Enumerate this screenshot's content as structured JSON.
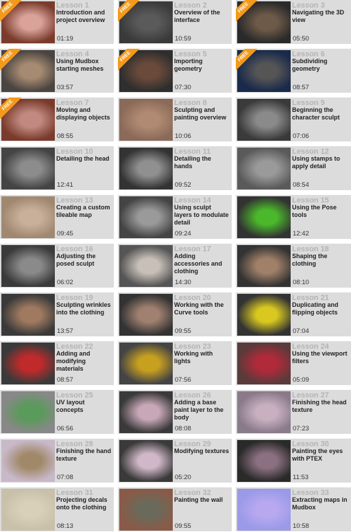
{
  "badge_label": "FREE",
  "lessons": [
    {
      "label": "Lesson 1",
      "title": "Introduction and project overview",
      "duration": "01:19",
      "free": true,
      "thumb_colors": [
        "#7a3b2c",
        "#d9a39a",
        "#e8e4de"
      ]
    },
    {
      "label": "Lesson 2",
      "title": "Overview of the interface",
      "duration": "10:59",
      "free": true,
      "thumb_colors": [
        "#3a3a3a",
        "#5a5a5a",
        "#8a8f99"
      ]
    },
    {
      "label": "Lesson 3",
      "title": "Navigating the 3D view",
      "duration": "05:50",
      "free": true,
      "thumb_colors": [
        "#2a2a2a",
        "#6e5a48",
        "#3c3c3c"
      ]
    },
    {
      "label": "Lesson 4",
      "title": "Using Mudbox starting meshes",
      "duration": "03:57",
      "free": true,
      "thumb_colors": [
        "#4a4540",
        "#a68a72",
        "#7a6656"
      ]
    },
    {
      "label": "Lesson 5",
      "title": "Importing geometry",
      "duration": "07:30",
      "free": true,
      "thumb_colors": [
        "#2e2e2e",
        "#6a4a3a",
        "#c8b020"
      ]
    },
    {
      "label": "Lesson 6",
      "title": "Subdividing geometry",
      "duration": "08:57",
      "free": true,
      "thumb_colors": [
        "#1a2a4a",
        "#555",
        "#777"
      ]
    },
    {
      "label": "Lesson 7",
      "title": "Moving and displaying objects",
      "duration": "08:55",
      "free": true,
      "thumb_colors": [
        "#7a3b2c",
        "#c08a80",
        "#6a3a3a"
      ]
    },
    {
      "label": "Lesson 8",
      "title": "Sculpting and painting overview",
      "duration": "10:06",
      "free": false,
      "thumb_colors": [
        "#8a6a58",
        "#b08a72",
        "#6a4e40"
      ]
    },
    {
      "label": "Lesson 9",
      "title": "Beginning the character sculpt",
      "duration": "07:06",
      "free": false,
      "thumb_colors": [
        "#3a3a3a",
        "#8a8a8a",
        "#4a4a4a"
      ]
    },
    {
      "label": "Lesson 10",
      "title": "Detailing the head",
      "duration": "12:41",
      "free": false,
      "thumb_colors": [
        "#444",
        "#8c8c8c",
        "#555"
      ]
    },
    {
      "label": "Lesson 11",
      "title": "Detailing the hands",
      "duration": "09:52",
      "free": false,
      "thumb_colors": [
        "#333",
        "#909090",
        "#444"
      ]
    },
    {
      "label": "Lesson 12",
      "title": "Using stamps to apply detail",
      "duration": "08:54",
      "free": false,
      "thumb_colors": [
        "#5a5a5a",
        "#9a9a9a",
        "#6a6a6a"
      ]
    },
    {
      "label": "Lesson 13",
      "title": "Creating a custom tileable map",
      "duration": "09:45",
      "free": false,
      "thumb_colors": [
        "#a08870",
        "#c8b09a",
        "#8a7058"
      ]
    },
    {
      "label": "Lesson 14",
      "title": "Using sculpt layers to modulate detail",
      "duration": "09:24",
      "free": false,
      "thumb_colors": [
        "#444",
        "#9a9a9a",
        "#555"
      ]
    },
    {
      "label": "Lesson 15",
      "title": "Using the Pose tools",
      "duration": "12:42",
      "free": false,
      "thumb_colors": [
        "#333",
        "#4ab82a",
        "#888"
      ]
    },
    {
      "label": "Lesson 16",
      "title": "Adjusting the posed sculpt",
      "duration": "06:02",
      "free": false,
      "thumb_colors": [
        "#3a3a3a",
        "#8a8a8a",
        "#4a4a4a"
      ]
    },
    {
      "label": "Lesson 17",
      "title": "Adding accessories and clothing",
      "duration": "14:30",
      "free": false,
      "thumb_colors": [
        "#555",
        "#c8c0b8",
        "#6a8aa0"
      ]
    },
    {
      "label": "Lesson 18",
      "title": "Shaping the clothing",
      "duration": "08:10",
      "free": false,
      "thumb_colors": [
        "#333",
        "#a08068",
        "#444"
      ]
    },
    {
      "label": "Lesson 19",
      "title": "Sculpting wrinkles into the clothing",
      "duration": "13:57",
      "free": false,
      "thumb_colors": [
        "#3a3a3a",
        "#a07a60",
        "#4a4a4a"
      ]
    },
    {
      "label": "Lesson 20",
      "title": "Working with the Curve tools",
      "duration": "09:55",
      "free": false,
      "thumb_colors": [
        "#333",
        "#a08070",
        "#555"
      ]
    },
    {
      "label": "Lesson 21",
      "title": "Duplicating and flipping objects",
      "duration": "07:04",
      "free": false,
      "thumb_colors": [
        "#333",
        "#d8c820",
        "#8a6a58"
      ]
    },
    {
      "label": "Lesson 22",
      "title": "Adding and modifying materials",
      "duration": "08:57",
      "free": false,
      "thumb_colors": [
        "#3a3a3a",
        "#c02a2a",
        "#4a4a4a"
      ]
    },
    {
      "label": "Lesson 23",
      "title": "Working with lights",
      "duration": "07:56",
      "free": false,
      "thumb_colors": [
        "#444",
        "#c8a020",
        "#b02a3a"
      ]
    },
    {
      "label": "Lesson 24",
      "title": "Using the viewport filters",
      "duration": "05:09",
      "free": false,
      "thumb_colors": [
        "#5a3a3a",
        "#b02a3a",
        "#e8c8b8"
      ]
    },
    {
      "label": "Lesson 25",
      "title": "UV layout concepts",
      "duration": "06:56",
      "free": false,
      "thumb_colors": [
        "#888",
        "#5a9a5a",
        "#bbb"
      ]
    },
    {
      "label": "Lesson 26",
      "title": "Adding a base paint layer to the body",
      "duration": "08:08",
      "free": false,
      "thumb_colors": [
        "#3a3a3a",
        "#c8a8b8",
        "#4a4a4a"
      ]
    },
    {
      "label": "Lesson 27",
      "title": "Finishing the head texture",
      "duration": "07:23",
      "free": false,
      "thumb_colors": [
        "#8a7a8a",
        "#c8b0c0",
        "#6a5a6a"
      ]
    },
    {
      "label": "Lesson 28",
      "title": "Finishing the hand texture",
      "duration": "07:08",
      "free": false,
      "thumb_colors": [
        "#c8b8c8",
        "#a08868",
        "#d8c8d8"
      ]
    },
    {
      "label": "Lesson 29",
      "title": "Modifying textures",
      "duration": "05:20",
      "free": false,
      "thumb_colors": [
        "#3a3a3a",
        "#d0b8c8",
        "#888"
      ]
    },
    {
      "label": "Lesson 30",
      "title": "Painting the eyes with PTEX",
      "duration": "11:53",
      "free": false,
      "thumb_colors": [
        "#2a2a2a",
        "#8a7080",
        "#b09aa8"
      ]
    },
    {
      "label": "Lesson 31",
      "title": "Projecting decals onto the clothing",
      "duration": "08:13",
      "free": false,
      "thumb_colors": [
        "#c8c0a8",
        "#d8d0b8",
        "#8a8070"
      ]
    },
    {
      "label": "Lesson 32",
      "title": "Painting the wall",
      "duration": "09:55",
      "free": false,
      "thumb_colors": [
        "#8a5a48",
        "#6a6a5a",
        "#3a3a3a"
      ]
    },
    {
      "label": "Lesson 33",
      "title": "Extracting maps in Mudbox",
      "duration": "10:58",
      "free": false,
      "thumb_colors": [
        "#9a9ae8",
        "#b8a8f0",
        "#8a9ae0"
      ]
    }
  ]
}
